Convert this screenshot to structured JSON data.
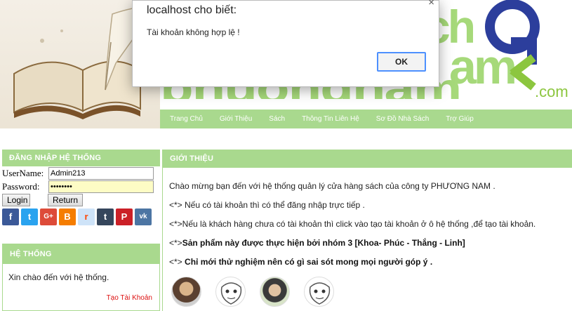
{
  "dialog": {
    "title": "localhost cho biết:",
    "message": "Tài khoản không hợp lệ !",
    "ok_label": "OK",
    "close_glyph": "×"
  },
  "banner": {
    "logo_text": "phuongnam",
    "logo_suffix": ".com",
    "nav": [
      "Trang Chủ",
      "Giới Thiệu",
      "Sách",
      "Thông Tin Liên Hệ",
      "Sơ Đồ Nhà Sách",
      "Trợ Giúp"
    ]
  },
  "login": {
    "title": "ĐĂNG NHẬP HỆ THỐNG",
    "username_label": "UserName:",
    "username_value": "Admin213",
    "password_label": "Password:",
    "password_value": "••••••••",
    "login_button": "Login",
    "return_button": "Return",
    "social": [
      {
        "name": "facebook-icon",
        "glyph": "f",
        "color": "#3b5998"
      },
      {
        "name": "twitter-icon",
        "glyph": "t",
        "color": "#2aa3ef"
      },
      {
        "name": "google-plus-icon",
        "glyph": "G+",
        "color": "#dd4b39"
      },
      {
        "name": "blogger-icon",
        "glyph": "B",
        "color": "#f57d00"
      },
      {
        "name": "reddit-icon",
        "glyph": "r",
        "color": "#cee3f8"
      },
      {
        "name": "tumblr-icon",
        "glyph": "t",
        "color": "#35465c"
      },
      {
        "name": "pinterest-icon",
        "glyph": "P",
        "color": "#cb2027"
      },
      {
        "name": "vk-icon",
        "glyph": "vk",
        "color": "#4c75a3"
      }
    ]
  },
  "system": {
    "title": "HỆ THỐNG",
    "greeting": "Xin chào đến với hệ thống.",
    "create_account": "Tạo Tài Khoản"
  },
  "intro": {
    "title": "GIỚI THIỆU",
    "line1": "Chào mừng bạn đến với hệ thống quản lý cửa hàng sách của công ty PHƯƠNG NAM .",
    "line2": "<*> Nếu có tài khoản thì có thể đăng nhập trực tiếp .",
    "line3": "<*>Nếu là khách hàng chưa có tài khoản thì click vào tạo tài khoản ở ô hệ thống ,để tạo tài khoản.",
    "line4_prefix": "<*>",
    "line4_bold": "Sản phẩm này được thực hiện bởi nhóm 3 [Khoa- Phúc - Thắng - Linh]",
    "line5_prefix": "<*> ",
    "line5_bold": "Chỉ mới thử nghiệm nên có gì sai sót mong mọi người góp ý ."
  }
}
